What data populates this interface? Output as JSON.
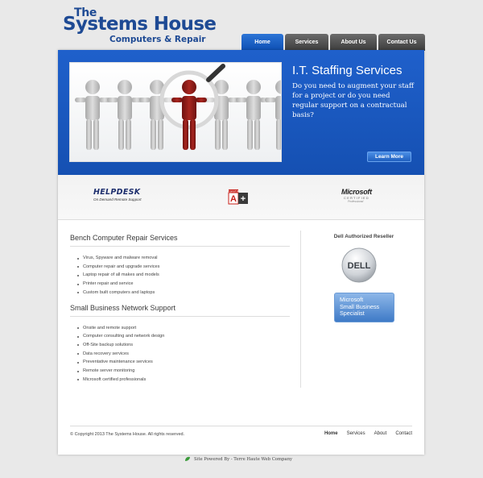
{
  "header": {
    "logo_line1": "The",
    "logo_line2": "Systems House",
    "logo_line3": "Computers & Repair"
  },
  "nav": {
    "items": [
      {
        "label": "Home",
        "active": true
      },
      {
        "label": "Services",
        "active": false
      },
      {
        "label": "About Us",
        "active": false
      },
      {
        "label": "Contact Us",
        "active": false
      }
    ]
  },
  "hero": {
    "title": "I.T. Staffing Services",
    "text": "Do you need to augment your staff for a project or do you need regular support on a contractual basis?",
    "button_label": "Learn More"
  },
  "partner_logos": {
    "helpdesk_title": "HELPDESK",
    "helpdesk_sub": "On Demand Remote Support",
    "comptia_label": "CompTIA",
    "comptia_grade": "A+",
    "ms_name": "Microsoft",
    "ms_cert": "CERTIFIED",
    "ms_prof": "Professional"
  },
  "main": {
    "section1_title": "Bench Computer Repair Services",
    "section1_items": [
      "Virus, Spyware and malware removal",
      "Computer repair and upgrade services",
      "Laptop repair of all makes and models",
      "Printer repair and service",
      "Custom built computers and laptops"
    ],
    "section2_title": "Small Business Network Support",
    "section2_items": [
      "Onsite and remote support",
      "Computer consulting and network design",
      "Off-Site backup solutions",
      "Data recovery services",
      "Preventative maintenance services",
      "Remote server monitoring",
      "Microsoft certified professionals"
    ]
  },
  "sidebar": {
    "title": "Dell Authorized Reseller",
    "dell_logo_text": "DELL",
    "ms_sb_line1": "Microsoft",
    "ms_sb_line2": "Small Business",
    "ms_sb_line3": "Specialist"
  },
  "footer": {
    "copyright": "© Copyright 2013 The Systems House. All rights reserved.",
    "nav": [
      {
        "label": "Home",
        "active": true
      },
      {
        "label": "Services",
        "active": false
      },
      {
        "label": "About",
        "active": false
      },
      {
        "label": "Contact",
        "active": false
      }
    ],
    "powered_by": "Site Powered By - Terre Haute Web Company"
  },
  "colors": {
    "brand_blue": "#1e4a94",
    "hero_blue": "#1f60cb",
    "nav_active": "#0d4fb3",
    "nav_inactive": "#4a4a4a",
    "figure_red": "#8e1a17",
    "figure_gray": "#c0c0c0"
  }
}
